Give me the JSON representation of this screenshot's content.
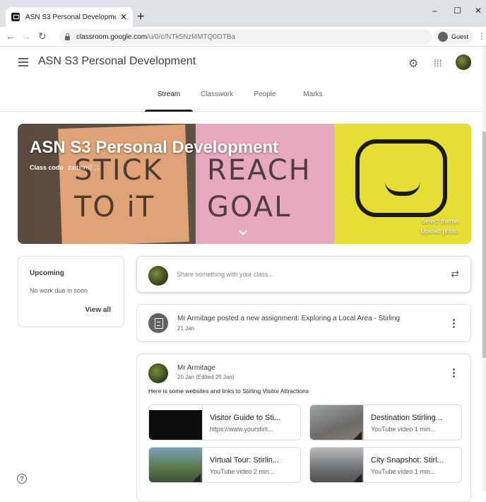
{
  "browser": {
    "tab_title": "ASN S3 Personal Development",
    "url_host": "classroom.google.com",
    "url_path": "/u/0/c/NTk5Nzl4MTQ0OTBa",
    "profile": "Guest"
  },
  "header": {
    "app_title": "ASN S3 Personal Development",
    "tabs": [
      {
        "label": "Stream"
      },
      {
        "label": "Classwork"
      },
      {
        "label": "People"
      },
      {
        "label": "Marks"
      }
    ]
  },
  "banner": {
    "title": "ASN S3 Personal Development",
    "class_code_label": "Class code",
    "class_code": "zarbnm7",
    "select_theme": "Select theme",
    "upload_photo": "Upload photo",
    "notes_text": [
      "STICK TO iT",
      "REACH GOAL"
    ]
  },
  "upcoming": {
    "title": "Upcoming",
    "empty_text": "No work due in soon",
    "view_all": "View all"
  },
  "share": {
    "placeholder": "Share something with your class..."
  },
  "assignment": {
    "text": "Mr Armitage posted a new assignment: Exploring a Local Area - Stirling",
    "date": "21 Jan"
  },
  "post": {
    "author": "Mr Armitage",
    "date": "20 Jan (Edited 20 Jan)",
    "body": "Here is some websites and links to Stirling Visitor Attractions",
    "attachments": [
      {
        "title": "Visitor Guide to Sti...",
        "subtitle": "https://www.yourstirli..."
      },
      {
        "title": "Destination Stirling...",
        "subtitle": "YouTube video  1 min..."
      },
      {
        "title": "Virtual Tour: Stirlin...",
        "subtitle": "YouTube video  2 min..."
      },
      {
        "title": "City Snapshot: Stirl...",
        "subtitle": "YouTube video  1 min..."
      }
    ]
  },
  "colors": {
    "accent": "#202124",
    "note_orange": "#e0a377",
    "note_pink": "#e8a9c0",
    "note_yellow": "#e6dd35"
  }
}
